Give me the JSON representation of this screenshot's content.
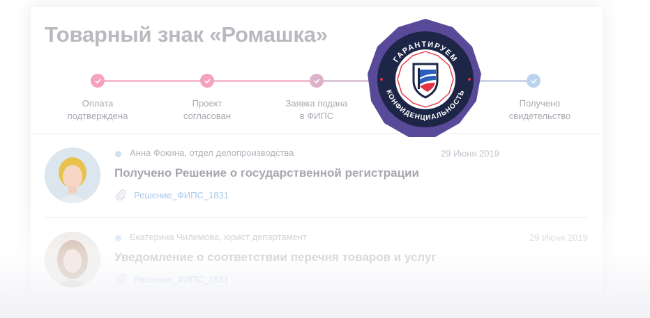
{
  "page": {
    "title": "Товарный знак «Ромашка»"
  },
  "steps": [
    {
      "label_line1": "Оплата",
      "label_line2": "подтверждена",
      "status": "done",
      "color": "#f5a3bd"
    },
    {
      "label_line1": "Проект",
      "label_line2": "согласован",
      "status": "done",
      "color": "#f5a3bd"
    },
    {
      "label_line1": "Заявка подана",
      "label_line2": "в ФИПС",
      "status": "done",
      "color": "#dfb2cb"
    },
    {
      "label_line1": "Получено",
      "label_line2": "свидетельство",
      "status": "done",
      "color": "#bcd2ef"
    }
  ],
  "messages": [
    {
      "author": "Анна Фокина, отдел делопроизводства",
      "date": "29 Июня 2019",
      "title": "Получено Решение о государственной регистрации",
      "attachment": "Решение_ФИПС_1831"
    },
    {
      "author": "Екатерина Чилимова, юрист департамент",
      "date": "29 Июня 2019",
      "title": "Уведомление о соответствии перечня товаров и услуг",
      "attachment": "Решение_ФИПС_1831"
    }
  ],
  "seal": {
    "top_text": "ГАРАНТИРУЕМ",
    "bottom_text": "КОНФИДЕНЦИАЛЬНОСТЬ",
    "icon": "shield-icon"
  },
  "colors": {
    "seal_outer": "#594a99",
    "seal_ring": "#1d2647",
    "seal_accent": "#e03344",
    "shield_blue": "#2a5fbd"
  }
}
